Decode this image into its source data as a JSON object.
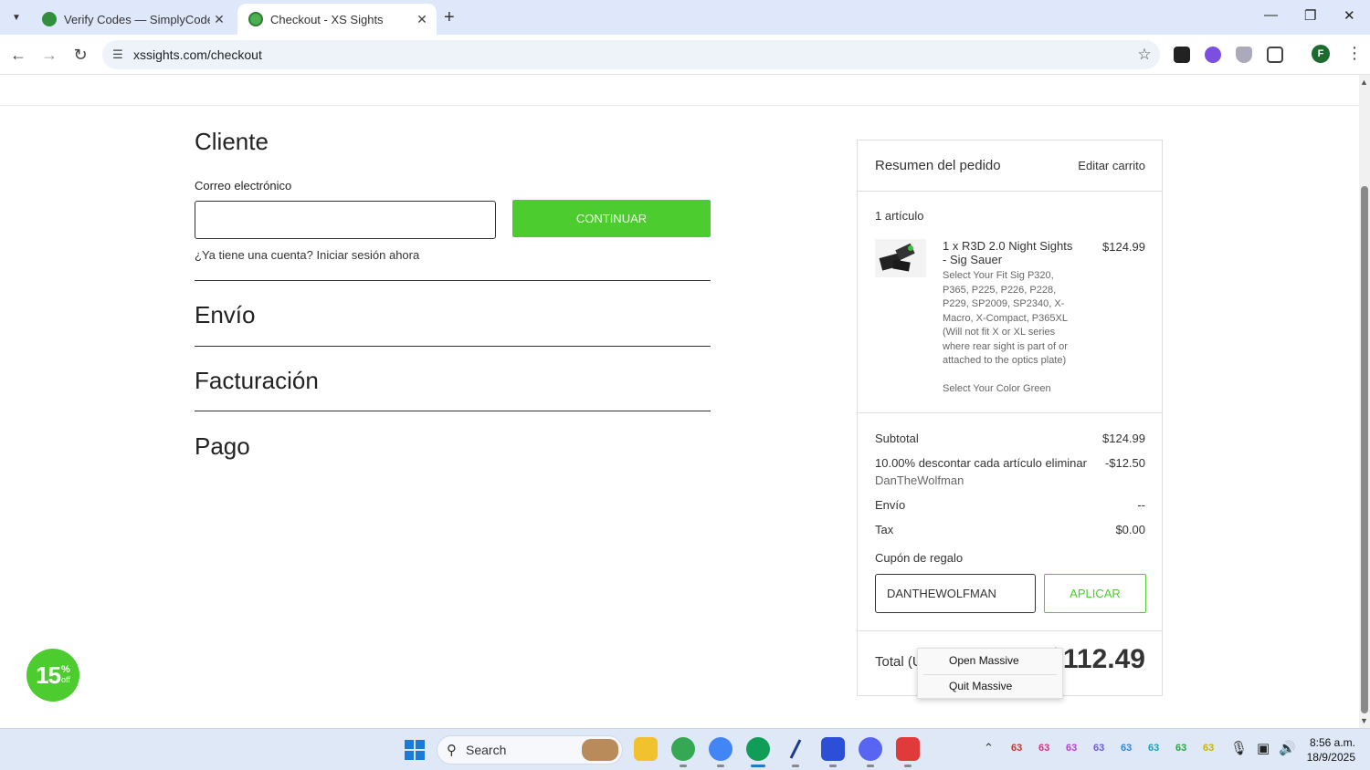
{
  "browser": {
    "tabs": [
      {
        "title": "Verify Codes — SimplyCodes",
        "active": false
      },
      {
        "title": "Checkout - XS Sights",
        "active": true
      }
    ],
    "url": "xssights.com/checkout",
    "profile_initial": "F"
  },
  "checkout": {
    "customer_heading": "Cliente",
    "email_label": "Correo electrónico",
    "email_value": "",
    "continue_label": "CONTINUAR",
    "login_prompt": "¿Ya tiene una cuenta?",
    "login_link": "Iniciar sesión ahora",
    "shipping_heading": "Envío",
    "billing_heading": "Facturación",
    "payment_heading": "Pago"
  },
  "summary": {
    "title": "Resumen del pedido",
    "edit_cart": "Editar carrito",
    "item_count": "1 artículo",
    "item": {
      "name": "1 x R3D 2.0 Night Sights - Sig Sauer",
      "price": "$124.99",
      "option_fit": "Select Your Fit Sig P320, P365, P225, P226, P228, P229, SP2009, SP2340, X-Macro, X-Compact, P365XL (Will not fit X or XL series where rear sight is part of or attached to the optics plate)",
      "option_color": "Select Your Color Green"
    },
    "subtotal_label": "Subtotal",
    "subtotal_value": "$124.99",
    "discount_label": "10.00% descontar cada artículo eliminar",
    "discount_code": "DanTheWolfman",
    "discount_value": "-$12.50",
    "shipping_label": "Envío",
    "shipping_value": "--",
    "tax_label": "Tax",
    "tax_value": "$0.00",
    "coupon_label": "Cupón de regalo",
    "coupon_value": "DANTHEWOLFMAN",
    "apply_label": "APLICAR",
    "total_label": "Total (U",
    "total_value": "$112.49"
  },
  "context_menu": {
    "items": [
      "Open Massive",
      "Quit Massive"
    ]
  },
  "badge": {
    "percent": "15",
    "suffix_top": "%",
    "suffix_bottom": "off"
  },
  "taskbar": {
    "search_label": "Search",
    "tray_numbers": [
      "63",
      "63",
      "63",
      "63",
      "63",
      "63",
      "63",
      "63"
    ],
    "tray_colors": [
      "#c0392b",
      "#d63384",
      "#b83fd1",
      "#6f5bd6",
      "#2e86de",
      "#17a2b8",
      "#28a745",
      "#c9b400"
    ],
    "time": "8:56 a.m.",
    "date": "18/9/2025"
  },
  "colors": {
    "accent_green": "#4ccc2e",
    "chrome_bg": "#dfe8fb"
  }
}
